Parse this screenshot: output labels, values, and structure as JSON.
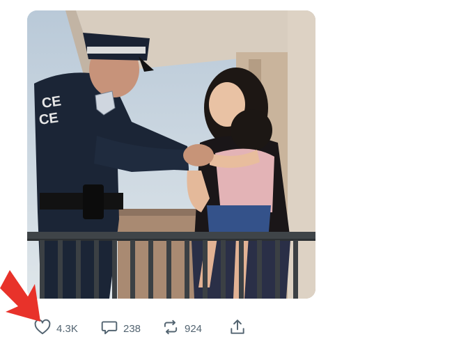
{
  "post": {
    "photo_icon": "photo-police-officer-mother-child",
    "actions": {
      "like": {
        "icon": "heart-icon",
        "count": "4.3K"
      },
      "reply": {
        "icon": "reply-bubble-icon",
        "count": "238"
      },
      "retweet": {
        "icon": "retweet-icon",
        "count": "924"
      },
      "share": {
        "icon": "share-icon"
      }
    }
  },
  "annotation": {
    "arrow_color": "#e8322a"
  },
  "colors": {
    "icon_gray": "#536471",
    "uniform": "#1b2536",
    "railing": "#3f4448"
  }
}
